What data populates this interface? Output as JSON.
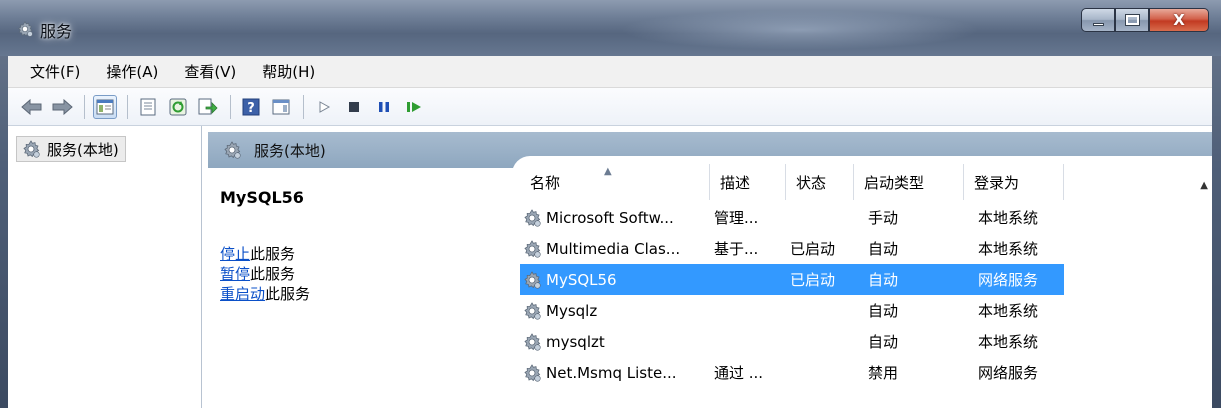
{
  "window": {
    "title": "服务",
    "icon": "services-gear-icon"
  },
  "menu": [
    "文件(F)",
    "操作(A)",
    "查看(V)",
    "帮助(H)"
  ],
  "toolbar": {
    "icons": [
      "back-arrow-icon",
      "forward-arrow-icon",
      "show-hide-console-tree-icon",
      "properties-icon",
      "refresh-icon",
      "export-list-icon",
      "help-icon",
      "action-pane-icon",
      "start-service-icon",
      "stop-service-icon",
      "pause-service-icon",
      "resume-service-icon"
    ]
  },
  "tree": {
    "item_label": "服务(本地)"
  },
  "pane": {
    "title": "服务(本地)"
  },
  "detail": {
    "service_name": "MySQL56",
    "actions": [
      {
        "link": "停止",
        "suffix": "此服务"
      },
      {
        "link": "暂停",
        "suffix": "此服务"
      },
      {
        "link": "重启动",
        "suffix": "此服务"
      }
    ]
  },
  "table": {
    "columns": [
      "名称",
      "描述",
      "状态",
      "启动类型",
      "登录为"
    ],
    "rows": [
      {
        "name": "Microsoft Softw...",
        "desc": "管理...",
        "status": "",
        "startup": "手动",
        "logon": "本地系统"
      },
      {
        "name": "Multimedia Clas...",
        "desc": "基于...",
        "status": "已启动",
        "startup": "自动",
        "logon": "本地系统"
      },
      {
        "name": "MySQL56",
        "desc": "",
        "status": "已启动",
        "startup": "自动",
        "logon": "网络服务"
      },
      {
        "name": "Mysqlz",
        "desc": "",
        "status": "",
        "startup": "自动",
        "logon": "本地系统"
      },
      {
        "name": "mysqlzt",
        "desc": "",
        "status": "",
        "startup": "自动",
        "logon": "本地系统"
      },
      {
        "name": "Net.Msmq Liste...",
        "desc": "通过 ...",
        "status": "",
        "startup": "禁用",
        "logon": "网络服务"
      }
    ],
    "selected_row": 2
  },
  "colors": {
    "selection": "#3399ff",
    "link": "#0b50c8",
    "pane_header": "#95adc4"
  }
}
